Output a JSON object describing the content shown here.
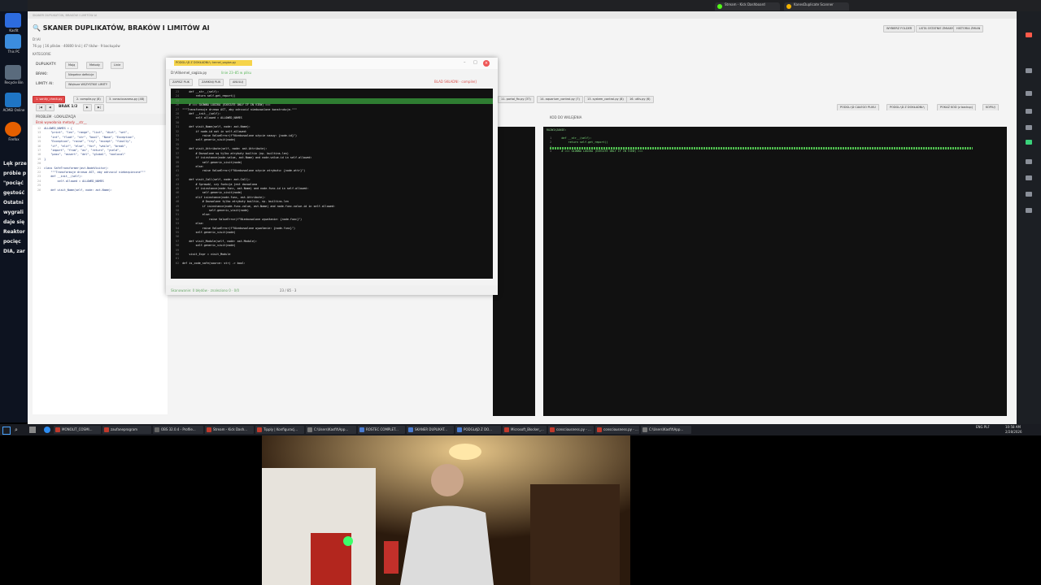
{
  "browser": {
    "tabs": [
      {
        "label": "Stream - Kick Dashboard",
        "color": "#53fc18"
      },
      {
        "label": "KanesDuplicate Scanner",
        "color": "#f4b400"
      }
    ]
  },
  "desktop": {
    "icons": [
      {
        "label": "Kasfit",
        "color": "#2d6cdf"
      },
      {
        "label": "This PC",
        "color": "#3c8dde"
      },
      {
        "label": "Recycle Bin",
        "color": "#5a6b7d"
      },
      {
        "label": "ACMEI Online",
        "color": "#1f75c4"
      },
      {
        "label": "Firefox",
        "color": "#e66000"
      }
    ]
  },
  "side_snippets": [
    "Lęk prze",
    "próbie p",
    "\"pociąć",
    "gęstość",
    "Ostatni",
    "wygrali",
    "daje się",
    "Reaktor",
    "pocięc",
    "DIA, zar"
  ],
  "app": {
    "title": "SKANER DUPLIKATÓW, BRAKÓW I LIMITÓW AI",
    "subtitle": "D:\\AI",
    "stats": "76 py | 16 plików · 40800 linii | 47 tików · 9 backupów",
    "kategorie": "KATEGORIE",
    "toolbar": [
      {
        "label": "WYBIERZ FOLDER"
      },
      {
        "label": "LISTA OSTATNIE ZMIANY"
      },
      {
        "label": "HISTORIA ZMIAN"
      }
    ],
    "rows": [
      {
        "label": "DUPLIKATY:",
        "buttons": [
          "Mają",
          "Metody",
          "Linie"
        ]
      },
      {
        "label": "BRAKI:",
        "buttons": [
          "Niepełne definicje"
        ]
      },
      {
        "label": "LIMITY AI:",
        "buttons": [
          "Większe WSZYSTKIE LIMITY"
        ]
      }
    ],
    "file_tabs": [
      "1. sanity_check.py",
      "2. compile.py (8)",
      "3. consciousness.py (48)"
    ],
    "file_tabs_right": [
      "11. portal_fix.py (37)",
      "14. aquarium_control.py (7)",
      "13. system_control.py (8)",
      "16. utils.py (6)"
    ],
    "brak_label": "BRAK 1/2",
    "left_panel_title": "PROBLEM · LOKALIZACJA",
    "left_panel_sub": "Brak wywołania metody __str__",
    "right_toolbar": [
      "PODGLĄD CAŁEGO PLIKU",
      "PODGLĄD Z DOKŁADNIĄ",
      "POKAŻ KOD (z backup)",
      "KOPIUJ"
    ],
    "kod_do_wklejenia": "KOD DO WKLEJENIA",
    "rozwiazanie": "ROZWIĄZANIE:",
    "right_code": [
      {
        "n": "1",
        "t": "    def __str__(self):"
      },
      {
        "n": "2",
        "t": "        return self.get_report()"
      },
      {
        "n": "3",
        "t": ""
      },
      {
        "n": "4",
        "t": "    # === GŁÓWNA LOGIKA (EXECUTE ONLY IF IN VIEW) ==="
      }
    ],
    "left_code": [
      {
        "n": "12",
        "t": "ALLOWED_NAMES = {"
      },
      {
        "n": "13",
        "t": "    \"print\", \"len\", \"range\", \"list\", \"dict\", \"set\","
      },
      {
        "n": "14",
        "t": "    \"int\", \"float\", \"str\", \"bool\", \"None\", \"Exception\","
      },
      {
        "n": "15",
        "t": "    \"Exception\", \"raise\", \"try\", \"except\", \"finally\","
      },
      {
        "n": "16",
        "t": "    \"if\", \"elif\", \"else\", \"for\", \"while\", \"break\","
      },
      {
        "n": "17",
        "t": "    \"import\", \"from\", \"as\", \"return\", \"yield\","
      },
      {
        "n": "18",
        "t": "    \"pass\", \"assert\", \"del\", \"global\", \"nonlocal\""
      },
      {
        "n": "19",
        "t": "}"
      },
      {
        "n": "20",
        "t": ""
      },
      {
        "n": "21",
        "t": "class SafeTransformer(ast.NodeVisitor):"
      },
      {
        "n": "22",
        "t": "    \"\"\"Transformuje drzewo AST, aby odrzucić niebezpieczne\"\"\""
      },
      {
        "n": "23",
        "t": "    def __init__(self):"
      },
      {
        "n": "24",
        "t": "        self.allowed = ALLOWED_NAMES"
      },
      {
        "n": "25",
        "t": ""
      },
      {
        "n": "26",
        "t": "    def visit_Name(self, node: ast.Name):"
      }
    ]
  },
  "float_window": {
    "title": "PODGLĄD Z DOKŁADNIĄ: kernel_sagiza.py",
    "path": "D:\\AI\\kernel_sagiza.py",
    "path_note": "linie 23–85 w pliku",
    "buttons": [
      "ZAPISZ PLIK",
      "ZAMKNIJ PLIK",
      "ANULUJ"
    ],
    "warning": "BLAD SKŁADNI · compile()",
    "status": "Skanowanie: 0 błędów · znaleziono 0 · 0/0",
    "status_right": "23 / 85 · 3",
    "code": [
      {
        "n": "23",
        "t": "    def __str__(self):"
      },
      {
        "n": "24",
        "t": "        return self.get_report()"
      },
      {
        "n": "25",
        "t": ""
      },
      {
        "n": "26",
        "t": "    # === GŁÓWNA LOGIKA (EXECUTE ONLY IF IN VIEW) ==="
      },
      {
        "n": "27",
        "t": "\"\"\"Transformuje drzewo AST, aby odrzucić niedozwolone konstrukcje.\"\"\""
      },
      {
        "n": "28",
        "t": "    def __init__(self):"
      },
      {
        "n": "29",
        "t": "        self.allowed = ALLOWED_NAMES"
      },
      {
        "n": "30",
        "t": ""
      },
      {
        "n": "31",
        "t": "    def visit_Name(self, node: ast.Name):"
      },
      {
        "n": "32",
        "t": "        if node.id not in self.allowed:"
      },
      {
        "n": "33",
        "t": "            raise ValueError(f\"Niedozwolone użycie nazwy: {node.id}\")"
      },
      {
        "n": "34",
        "t": "        self.generic_visit(node)"
      },
      {
        "n": "35",
        "t": ""
      },
      {
        "n": "36",
        "t": "    def visit_Attribute(self, node: ast.Attribute):"
      },
      {
        "n": "37",
        "t": "        # Dozwolone są tylko atrybuty builtin (np. builtins.len)"
      },
      {
        "n": "38",
        "t": "        if isinstance(node.value, ast.Name) and node.value.id in self.allowed:"
      },
      {
        "n": "39",
        "t": "            self.generic_visit(node)"
      },
      {
        "n": "40",
        "t": "        else:"
      },
      {
        "n": "41",
        "t": "            raise ValueError(f\"Niedozwolone użycie atrybutu: {node.attr}\")"
      },
      {
        "n": "42",
        "t": ""
      },
      {
        "n": "43",
        "t": "    def visit_Call(self, node: ast.Call):"
      },
      {
        "n": "44",
        "t": "        # Sprawdź, czy funkcja jest dozwolona"
      },
      {
        "n": "45",
        "t": "        if isinstance(node.func, ast.Name) and node.func.id in self.allowed:"
      },
      {
        "n": "46",
        "t": "            self.generic_visit(node)"
      },
      {
        "n": "47",
        "t": "        elif isinstance(node.func, ast.Attribute):"
      },
      {
        "n": "48",
        "t": "            # Dozwolone tylko atrybuty builtin, np. builtins.len"
      },
      {
        "n": "49",
        "t": "            if isinstance(node.func.value, ast.Name) and node.func.value.id in self.allowed:"
      },
      {
        "n": "50",
        "t": "                self.generic_visit(node)"
      },
      {
        "n": "51",
        "t": "            else:"
      },
      {
        "n": "52",
        "t": "                raise ValueError(f\"Niedozwolone wywołanie: {node.func}\")"
      },
      {
        "n": "53",
        "t": "        else:"
      },
      {
        "n": "54",
        "t": "            raise ValueError(f\"Niedozwolone wywołanie: {node.func}\")"
      },
      {
        "n": "55",
        "t": "        self.generic_visit(node)"
      },
      {
        "n": "56",
        "t": ""
      },
      {
        "n": "57",
        "t": "    def visit_Module(self, node: ast.Module):"
      },
      {
        "n": "58",
        "t": "        self.generic_visit(node)"
      },
      {
        "n": "59",
        "t": ""
      },
      {
        "n": "60",
        "t": "    visit_Expr = visit_Module"
      },
      {
        "n": "61",
        "t": ""
      },
      {
        "n": "62",
        "t": "def is_code_safe(source: str) -> bool:"
      }
    ]
  },
  "taskbar": {
    "items": [
      {
        "label": "MONOLIT_COSMI...",
        "color": "#c0392b"
      },
      {
        "label": "zaufaneprogram",
        "color": "#c0392b"
      },
      {
        "label": "OBS 32.0.4 - Profile...",
        "color": "#666"
      },
      {
        "label": "Stream - Kick Dash...",
        "color": "#c0392b"
      },
      {
        "label": "Tipply | Konfiguracj...",
        "color": "#c0392b"
      },
      {
        "label": "C:\\Users\\Kasfit\\App...",
        "color": "#777"
      },
      {
        "label": "ROSTEC COMPLET...",
        "color": "#4a7bd0"
      },
      {
        "label": "SKANER DUPLIKAT...",
        "color": "#4a7bd0"
      },
      {
        "label": "PODGLĄD Z DO...",
        "color": "#4a7bd0"
      },
      {
        "label": "Microsoft_Blocker_...",
        "color": "#c0392b"
      },
      {
        "label": "consciousness.py - ...",
        "color": "#c0392b"
      },
      {
        "label": "consciousness.py - ...",
        "color": "#c0392b"
      },
      {
        "label": "C:\\Users\\Kasfit\\App...",
        "color": "#777"
      }
    ],
    "lang": "ENG PLF",
    "time": "10:58 AM",
    "date": "2/28/2026"
  }
}
